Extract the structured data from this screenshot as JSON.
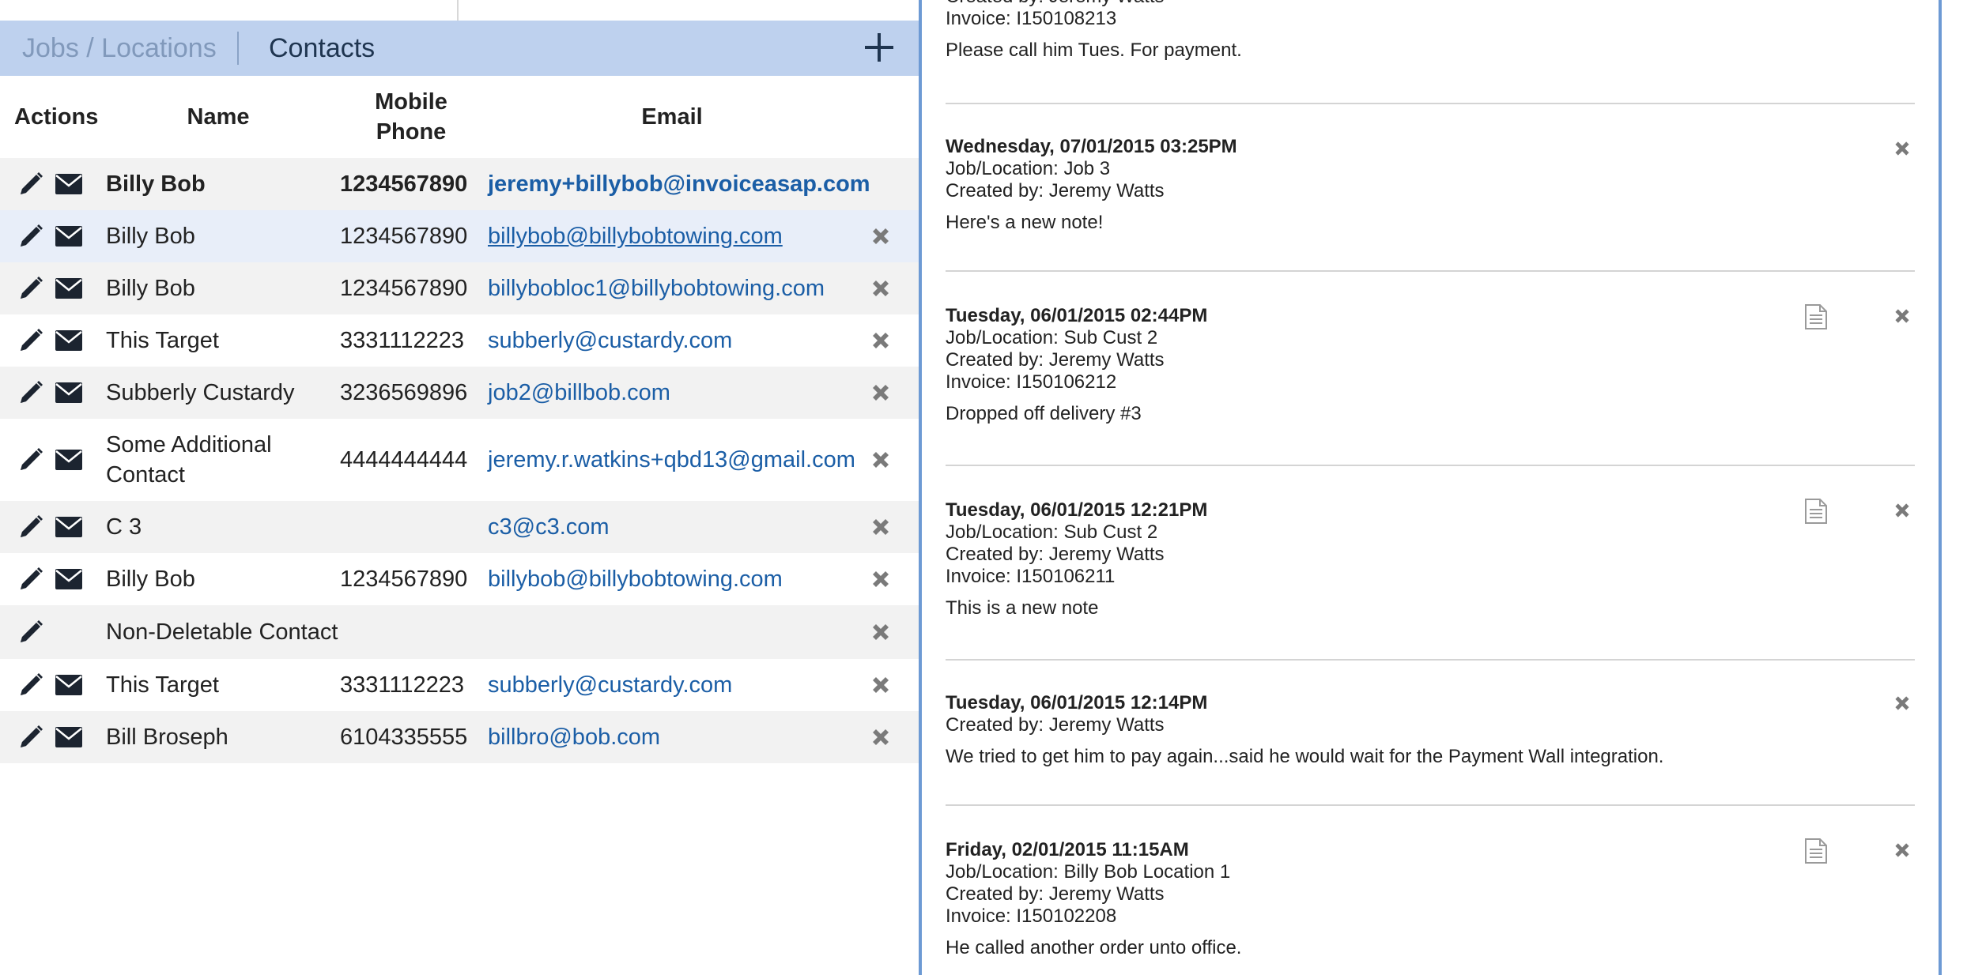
{
  "tabs": {
    "jobs_label": "Jobs / Locations",
    "contacts_label": "Contacts"
  },
  "table": {
    "headers": {
      "actions": "Actions",
      "name": "Name",
      "phone_line1": "Mobile",
      "phone_line2": "Phone",
      "email": "Email"
    },
    "rows": [
      {
        "name": "Billy Bob",
        "phone": "1234567890",
        "email": "jeremy+billybob@invoiceasap.com"
      },
      {
        "name": "Billy Bob",
        "phone": "1234567890",
        "email": "billybob@billybobtowing.com"
      },
      {
        "name": "Billy Bob",
        "phone": "1234567890",
        "email": "billybobloc1@billybobtowing.com"
      },
      {
        "name": "This Target",
        "phone": "3331112223",
        "email": "subberly@custardy.com"
      },
      {
        "name": "Subberly Custardy",
        "phone": "3236569896",
        "email": "job2@billbob.com"
      },
      {
        "name_line1": "Some Additional",
        "name_line2": "Contact",
        "phone": "4444444444",
        "email": "jeremy.r.watkins+qbd13@gmail.com"
      },
      {
        "name": "C 3",
        "phone": "",
        "email": "c3@c3.com"
      },
      {
        "name": "Billy Bob",
        "phone": "1234567890",
        "email": "billybob@billybobtowing.com"
      },
      {
        "name": "Non-Deletable Contact",
        "phone": "",
        "email": ""
      },
      {
        "name": "This Target",
        "phone": "3331112223",
        "email": "subberly@custardy.com"
      },
      {
        "name": "Bill Broseph",
        "phone": "6104335555",
        "email": "billbro@bob.com"
      }
    ]
  },
  "notes": [
    {
      "line1": "Created by: Jeremy Watts",
      "line2": "Invoice: I150108213",
      "body": "Please call him Tues. For payment."
    },
    {
      "date": "Wednesday, 07/01/2015 03:25PM",
      "line1": "Job/Location: Job 3",
      "line2": "Created by: Jeremy Watts",
      "body": "Here's a new note!"
    },
    {
      "date": "Tuesday, 06/01/2015 02:44PM",
      "line1": "Job/Location: Sub Cust 2",
      "line2": "Created by: Jeremy Watts",
      "line3": "Invoice: I150106212",
      "body": "Dropped off delivery #3"
    },
    {
      "date": "Tuesday, 06/01/2015 12:21PM",
      "line1": "Job/Location: Sub Cust 2",
      "line2": "Created by: Jeremy Watts",
      "line3": "Invoice: I150106211",
      "body": "This is a new note"
    },
    {
      "date": "Tuesday, 06/01/2015 12:14PM",
      "line1": "Created by: Jeremy Watts",
      "body": "We tried to get him to pay again...said he would wait for the Payment Wall integration."
    },
    {
      "date": "Friday, 02/01/2015 11:15AM",
      "line1": "Job/Location: Billy Bob Location 1",
      "line2": "Created by: Jeremy Watts",
      "line3": "Invoice: I150102208",
      "body": "He called another order unto office."
    }
  ],
  "colors": {
    "tabbar": "#bed1ee",
    "link": "#1b5ea6",
    "panel_border": "#6d9ad4"
  }
}
